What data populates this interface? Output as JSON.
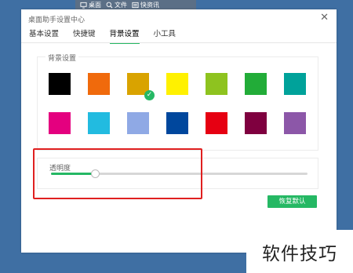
{
  "taskbar": {
    "items": [
      {
        "label": "桌面",
        "icon": "monitor-icon"
      },
      {
        "label": "文件",
        "icon": "search-icon"
      },
      {
        "label": "快资讯",
        "icon": "news-icon"
      }
    ]
  },
  "dialog": {
    "title": "桌面助手设置中心",
    "close_glyph": "✕"
  },
  "tabs": [
    {
      "label": "基本设置",
      "active": false
    },
    {
      "label": "快捷键",
      "active": false
    },
    {
      "label": "背景设置",
      "active": true
    },
    {
      "label": "小工具",
      "active": false
    }
  ],
  "background": {
    "section_title": "背景设置",
    "swatches": [
      "#000000",
      "#f06a0c",
      "#d9a300",
      "#fff100",
      "#8ec31f",
      "#22ac38",
      "#00a29a",
      "#e4007f",
      "#22bbe0",
      "#8fa9e5",
      "#00479d",
      "#e60012",
      "#7f003f",
      "#8c57a8"
    ],
    "selected_index": 2
  },
  "opacity": {
    "label": "透明度",
    "value": 0.17
  },
  "reset_button": "恢复默认",
  "watermark": "软件技巧",
  "colors": {
    "accent": "#25b864",
    "highlight": "#e02020",
    "desktop": "#3f6fa3"
  }
}
